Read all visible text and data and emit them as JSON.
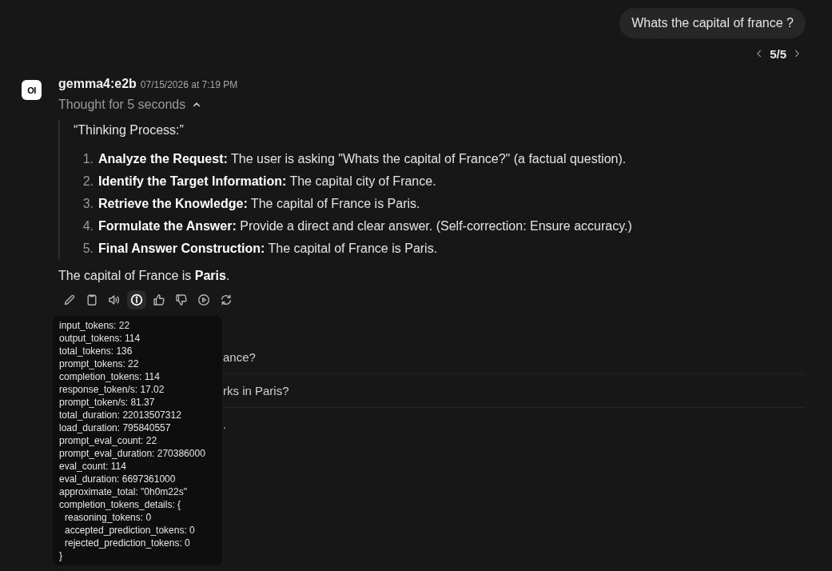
{
  "user_message": {
    "text": "Whats the capital of france ?"
  },
  "pager": {
    "text": "5/5"
  },
  "assistant": {
    "avatar_text": "OI",
    "model": "gemma4:e2b",
    "timestamp": "07/15/2026 at 7:19 PM",
    "thought": {
      "label": "Thought for 5 seconds",
      "expanded": true,
      "heading": "“Thinking Process:”",
      "steps": [
        {
          "number": "1.",
          "text": "**Analyze the Request:** The user is asking \"Whats the capital of France?\" (a factual question)."
        },
        {
          "number": "2.",
          "text": "**Identify the Target Information:** The capital city of France."
        },
        {
          "number": "3.",
          "text": "**Retrieve the Knowledge:** The capital of France is Paris."
        },
        {
          "number": "4.",
          "text": "**Formulate the Answer:** Provide a direct and clear answer. (Self-correction: Ensure accuracy.)"
        },
        {
          "number": "5.",
          "text": "**Final Answer Construction:** The capital of France is Paris."
        }
      ]
    },
    "answer": "The capital of France is **Paris**.",
    "actions": [
      {
        "kind": "edit",
        "selected": false
      },
      {
        "kind": "copy",
        "selected": false
      },
      {
        "kind": "read_aloud",
        "selected": false
      },
      {
        "kind": "info",
        "selected": true
      },
      {
        "kind": "good",
        "selected": false
      },
      {
        "kind": "bad",
        "selected": false
      },
      {
        "kind": "continue",
        "selected": false
      },
      {
        "kind": "regenerate",
        "selected": false
      }
    ],
    "info_tooltip": {
      "lines": [
        {
          "text": "input_tokens: 22"
        },
        {
          "text": "output_tokens: 114"
        },
        {
          "text": "total_tokens: 136"
        },
        {
          "text": "prompt_tokens: 22"
        },
        {
          "text": "completion_tokens: 114"
        },
        {
          "text": "response_token/s: 17.02"
        },
        {
          "text": "prompt_token/s: 81.37"
        },
        {
          "text": "total_duration: 22013507312"
        },
        {
          "text": "load_duration: 795840557"
        },
        {
          "text": "prompt_eval_count: 22"
        },
        {
          "text": "prompt_eval_duration: 270386000"
        },
        {
          "text": "eval_count: 114"
        },
        {
          "text": "eval_duration: 6697361000"
        },
        {
          "text": "approximate_total: \"0h0m22s\""
        },
        {
          "text": "completion_tokens_details: {",
          "children": [
            {
              "text": "reasoning_tokens: 0"
            },
            {
              "text": "accepted_prediction_tokens: 0"
            },
            {
              "text": "rejected_prediction_tokens: 0"
            }
          ]
        },
        {
          "text": "}"
        }
      ]
    },
    "follow_ups": [
      {
        "text": "ance?"
      },
      {
        "text": "rks in Paris?"
      },
      {
        "text": "."
      }
    ]
  }
}
